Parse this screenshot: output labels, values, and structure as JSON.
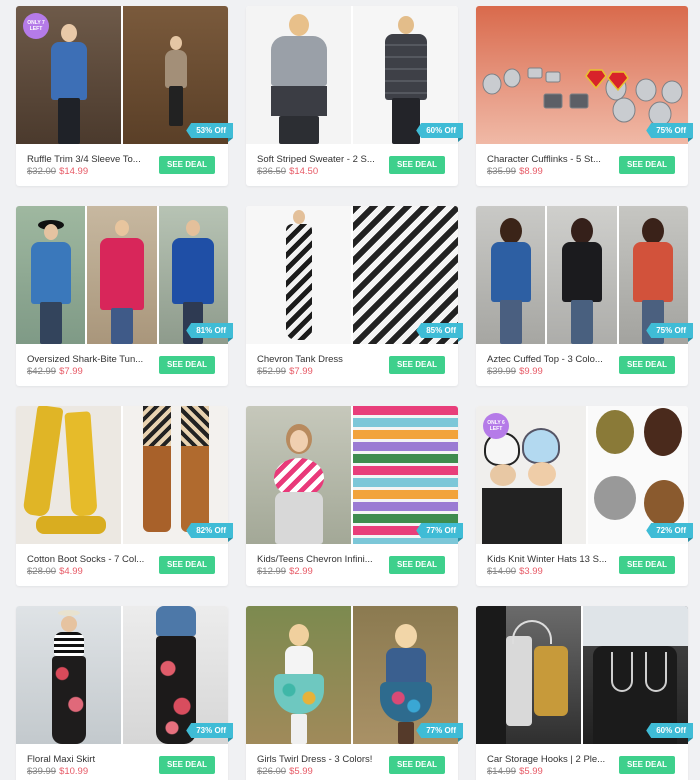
{
  "deal_label": "SEE DEAL",
  "only_left_text": "ONLY 7 LEFT",
  "only_left_text_2": "ONLY 6 LEFT",
  "colors": {
    "deal_button": "#3ed08c",
    "sale_price": "#e75a66",
    "discount_ribbon": "#3fbcd6",
    "only_left_badge": "#b57be8"
  },
  "products": [
    {
      "title": "Ruffle Trim 3/4 Sleeve To...",
      "old_price": "$32.00",
      "new_price": "$14.99",
      "discount": "53% Off"
    },
    {
      "title": "Soft Striped Sweater - 2 S...",
      "old_price": "$36.50",
      "new_price": "$14.50",
      "discount": "60% Off"
    },
    {
      "title": "Character Cufflinks - 5 St...",
      "old_price": "$35.99",
      "new_price": "$8.99",
      "discount": "75% Off"
    },
    {
      "title": "Oversized Shark-Bite Tun...",
      "old_price": "$42.99",
      "new_price": "$7.99",
      "discount": "81% Off"
    },
    {
      "title": "Chevron Tank Dress",
      "old_price": "$52.99",
      "new_price": "$7.99",
      "discount": "85% Off"
    },
    {
      "title": "Aztec Cuffed Top - 3 Colo...",
      "old_price": "$39.99",
      "new_price": "$9.99",
      "discount": "75% Off"
    },
    {
      "title": "Cotton Boot Socks - 7 Col...",
      "old_price": "$28.00",
      "new_price": "$4.99",
      "discount": "82% Off"
    },
    {
      "title": "Kids/Teens Chevron Infini...",
      "old_price": "$12.99",
      "new_price": "$2.99",
      "discount": "77% Off"
    },
    {
      "title": "Kids Knit Winter Hats 13 S...",
      "old_price": "$14.00",
      "new_price": "$3.99",
      "discount": "72% Off"
    },
    {
      "title": "Floral Maxi Skirt",
      "old_price": "$39.99",
      "new_price": "$10.99",
      "discount": "73% Off"
    },
    {
      "title": "Girls Twirl Dress - 3 Colors!",
      "old_price": "$26.00",
      "new_price": "$5.99",
      "discount": "77% Off"
    },
    {
      "title": "Car Storage Hooks | 2 Ple...",
      "old_price": "$14.99",
      "new_price": "$5.99",
      "discount": "60% Off"
    }
  ]
}
